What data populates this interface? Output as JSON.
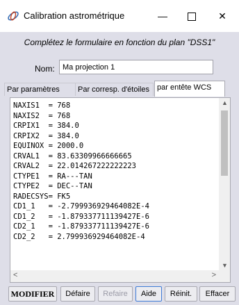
{
  "window": {
    "title": "Calibration astrométrique",
    "controls": {
      "minimize": "—",
      "maximize": "☐",
      "close": "✕"
    }
  },
  "instructions": "Complétez le formulaire en fonction du plan \"DSS1\"",
  "name_field": {
    "label": "Nom:",
    "value": "Ma projection 1"
  },
  "tabs": [
    {
      "label": "Par paramètres",
      "active": false
    },
    {
      "label": "Par corresp. d'étoiles",
      "active": false
    },
    {
      "label": "par entête WCS",
      "active": true
    }
  ],
  "wcs_header_lines": [
    "NAXIS1  = 768",
    "NAXIS2  = 768",
    "CRPIX1  = 384.0",
    "CRPIX2  = 384.0",
    "EQUINOX = 2000.0",
    "CRVAL1  = 83.63309966666665",
    "CRVAL2  = 22.014267222222223",
    "CTYPE1  = RA---TAN",
    "CTYPE2  = DEC--TAN",
    "RADECSYS= FK5",
    "CD1_1   = -2.799936929464082E-4",
    "CD1_2   = -1.879337711139427E-6",
    "CD2_1   = -1.879337711139427E-6",
    "CD2_2   = 2.799936929464082E-4"
  ],
  "buttons": {
    "modifier": "MODIFIER",
    "defaire": "Défaire",
    "refaire": "Refaire",
    "aide": "Aide",
    "reinit": "Réinit.",
    "effacer": "Effacer"
  }
}
